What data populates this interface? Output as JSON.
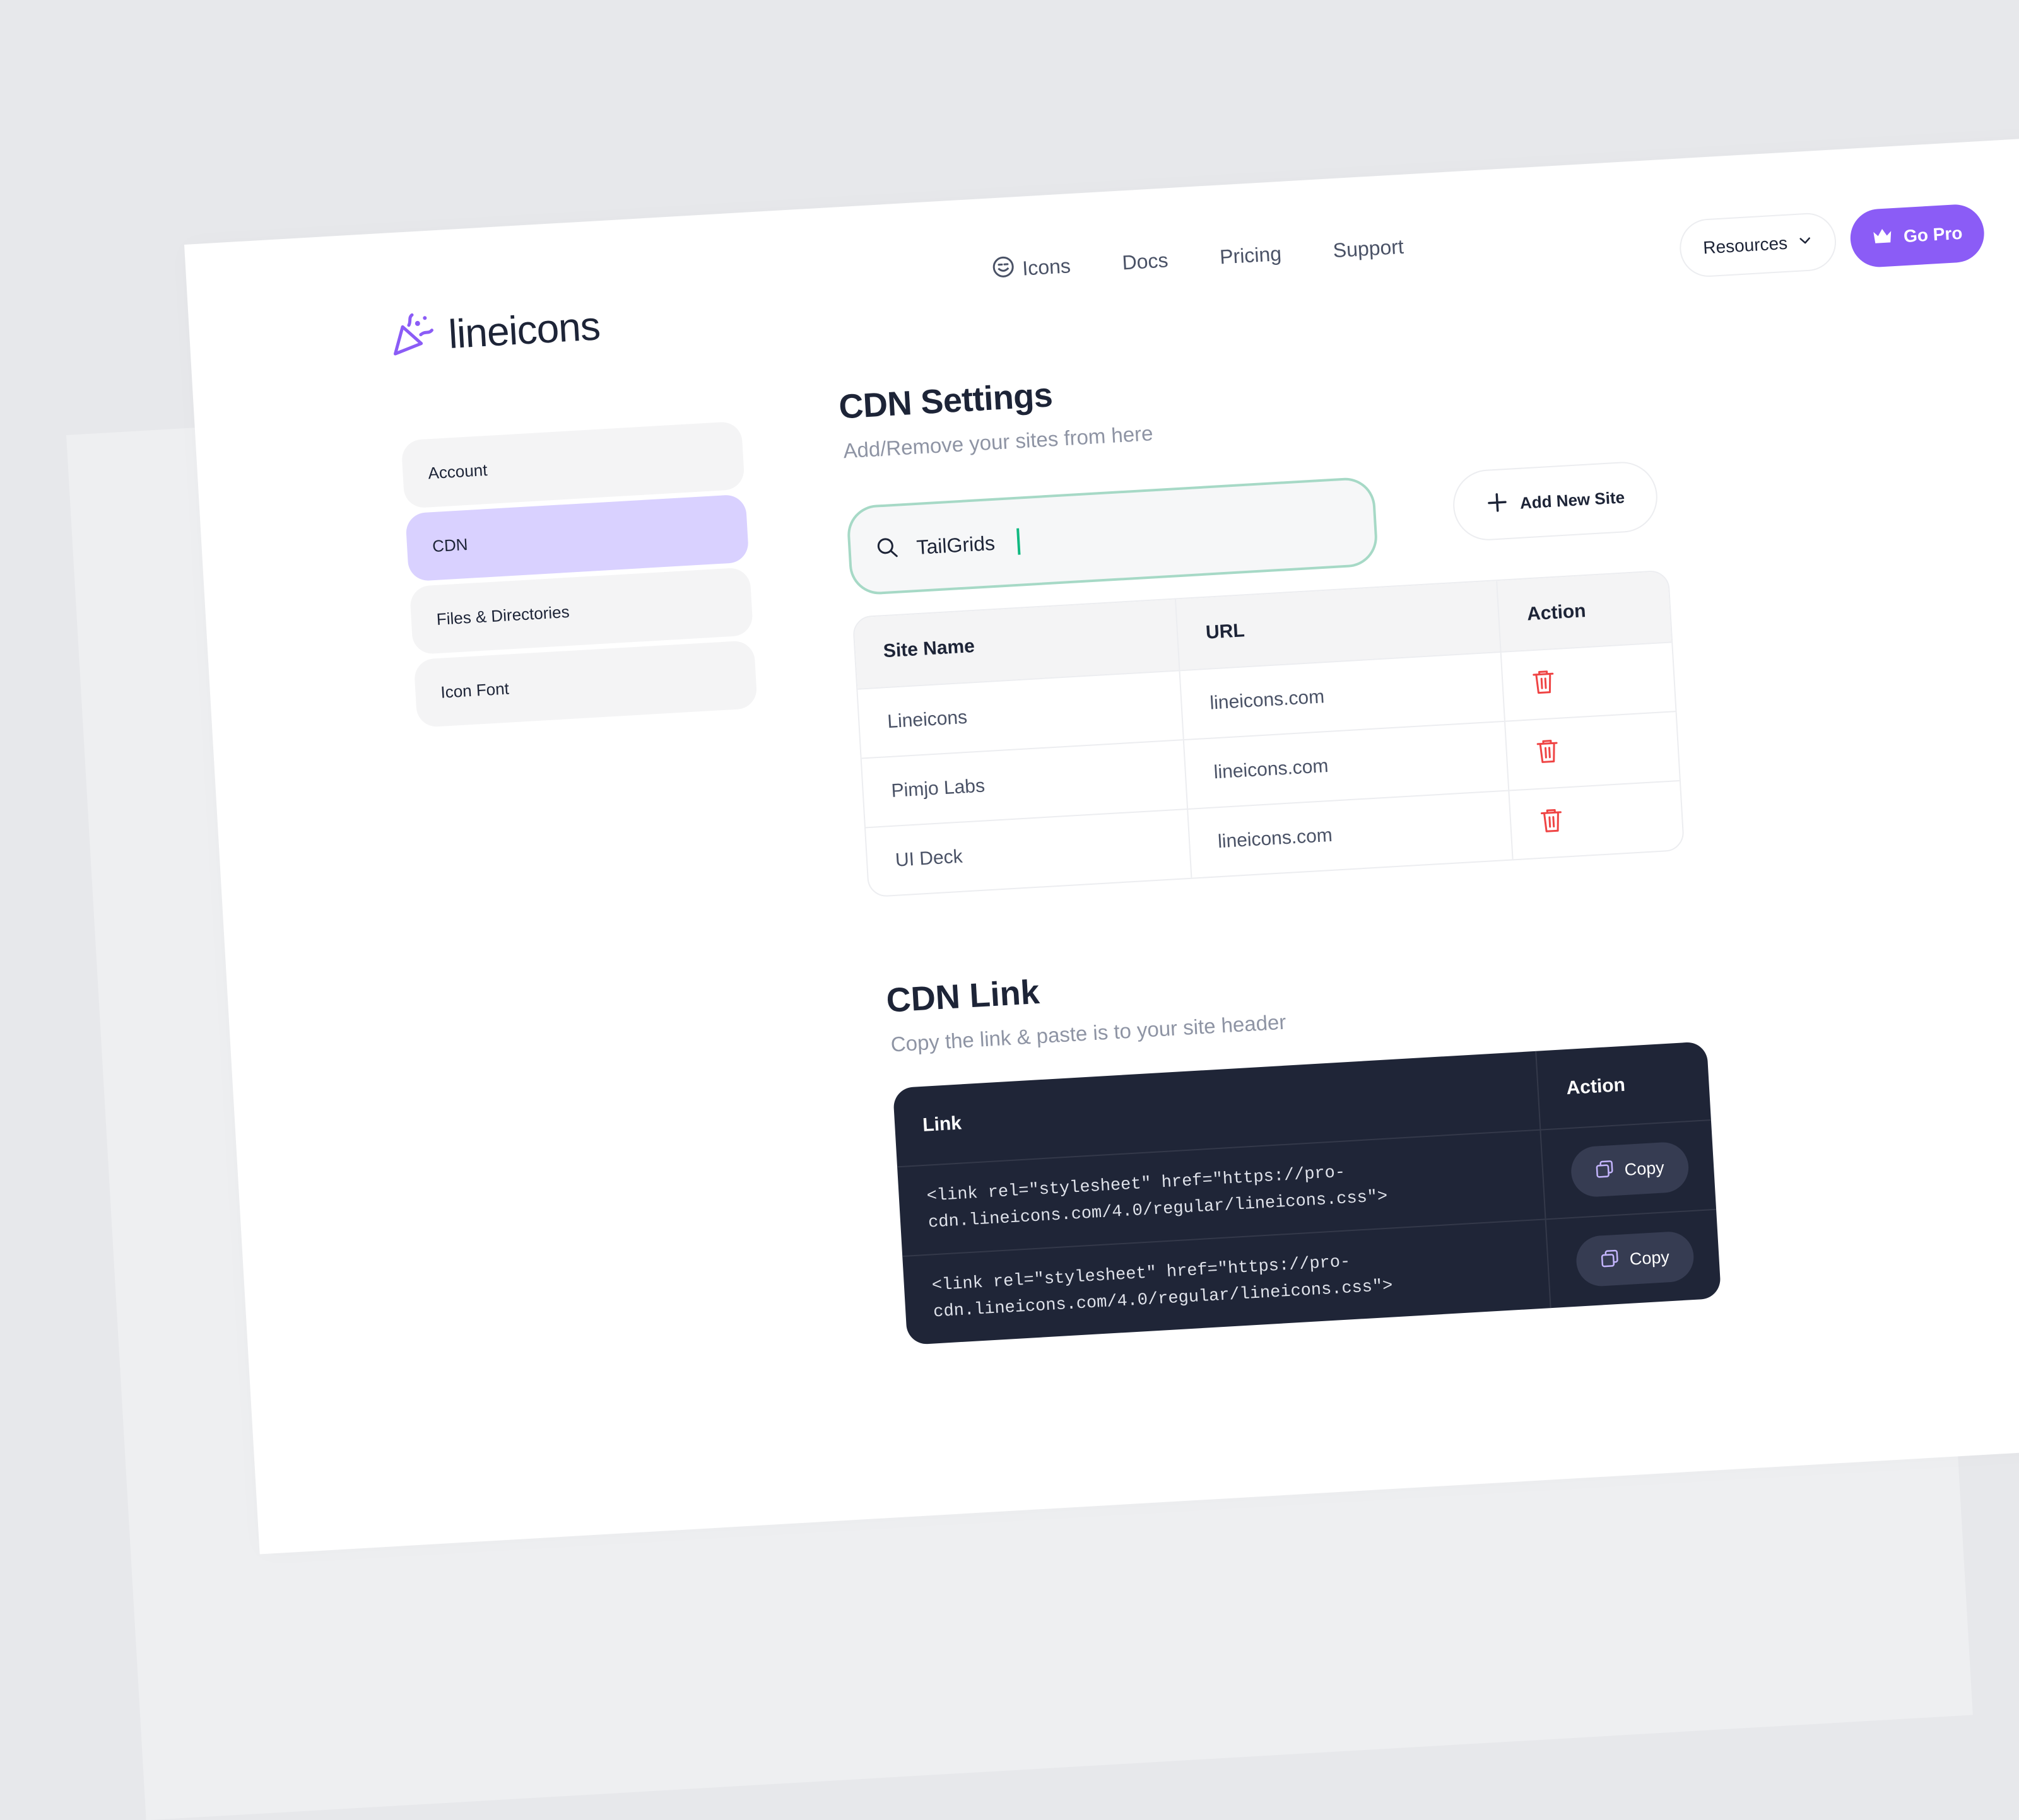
{
  "brand": {
    "name": "lineicons"
  },
  "nav": [
    {
      "label": "Icons",
      "icon": "smile-icon"
    },
    {
      "label": "Docs"
    },
    {
      "label": "Pricing"
    },
    {
      "label": "Support"
    }
  ],
  "header": {
    "resources_label": "Resources",
    "gopro_label": "Go Pro"
  },
  "sidebar": {
    "items": [
      {
        "label": "Account",
        "active": false
      },
      {
        "label": "CDN",
        "active": true
      },
      {
        "label": "Files & Directories",
        "active": false
      },
      {
        "label": "Icon Font",
        "active": false
      }
    ]
  },
  "cdn_settings": {
    "title": "CDN Settings",
    "subtitle": "Add/Remove your sites from here",
    "search_value": "TailGrids",
    "add_button": "Add New Site",
    "columns": [
      "Site Name",
      "URL",
      "Action"
    ],
    "rows": [
      {
        "site": "Lineicons",
        "url": "lineicons.com"
      },
      {
        "site": "Pimjo Labs",
        "url": "lineicons.com"
      },
      {
        "site": "UI Deck",
        "url": "lineicons.com"
      }
    ]
  },
  "cdn_link": {
    "title": "CDN Link",
    "subtitle": "Copy the link & paste is to your site header",
    "columns": [
      "Link",
      "Action"
    ],
    "rows": [
      {
        "code": "<link rel=\"stylesheet\" href=\"https://pro-\ncdn.lineicons.com/4.0/regular/lineicons.css\">",
        "action": "Copy"
      },
      {
        "code": "<link rel=\"stylesheet\" href=\"https://pro-\ncdn.lineicons.com/4.0/regular/lineicons.css\">",
        "action": "Copy"
      }
    ]
  },
  "colors": {
    "accent": "#8b5cf6",
    "active_bg": "#d9d1ff",
    "danger": "#ef4444",
    "dark_panel": "#1f2537"
  }
}
